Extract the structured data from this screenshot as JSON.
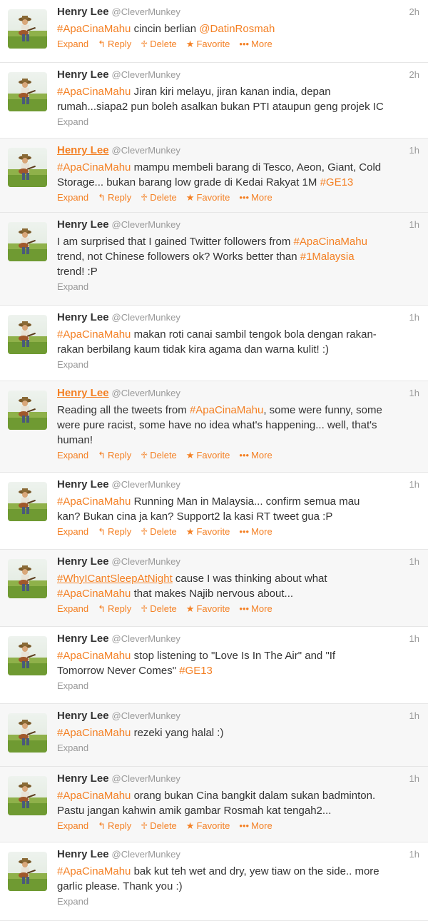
{
  "tweets": [
    {
      "name": "Henry Lee",
      "handle": "@CleverMunkey",
      "time": "2h",
      "lines": [
        [
          {
            "t": "#ApaCinaMahu",
            "h": true
          },
          {
            "t": " cincin berlian "
          },
          {
            "t": "@DatinRosmah",
            "h": true
          }
        ]
      ],
      "full_actions": true
    },
    {
      "name": "Henry Lee",
      "handle": "@CleverMunkey",
      "time": "2h",
      "lines": [
        [
          {
            "t": "#ApaCinaMahu",
            "h": true
          },
          {
            "t": " Jiran kiri melayu, jiran kanan india, depan"
          }
        ],
        [
          {
            "t": "rumah...siapa2 pun boleh asalkan bukan PTI ataupun geng projek IC"
          }
        ]
      ],
      "full_actions": false
    },
    {
      "name": "Henry Lee",
      "handle": "@CleverMunkey",
      "time": "1h",
      "name_hover": true,
      "lines": [
        [
          {
            "t": "#ApaCinaMahu",
            "h": true
          },
          {
            "t": " mampu membeli barang di Tesco, Aeon, Giant, Cold"
          }
        ],
        [
          {
            "t": "Storage... bukan barang low grade di Kedai Rakyat 1M "
          },
          {
            "t": "#GE13",
            "h": true
          }
        ]
      ],
      "full_actions": true
    },
    {
      "name": "Henry Lee",
      "handle": "@CleverMunkey",
      "time": "1h",
      "lines": [
        [
          {
            "t": "I am surprised that I gained Twitter followers from "
          },
          {
            "t": "#ApaCinaMahu",
            "h": true
          }
        ],
        [
          {
            "t": "trend, not Chinese followers ok? Works better than "
          },
          {
            "t": "#1Malaysia",
            "h": true
          }
        ],
        [
          {
            "t": "trend! :P"
          }
        ]
      ],
      "full_actions": false
    },
    {
      "name": "Henry Lee",
      "handle": "@CleverMunkey",
      "time": "1h",
      "lines": [
        [
          {
            "t": "#ApaCinaMahu",
            "h": true
          },
          {
            "t": " makan roti canai sambil tengok bola dengan rakan-"
          }
        ],
        [
          {
            "t": "rakan berbilang kaum tidak kira agama dan warna kulit! :)"
          }
        ]
      ],
      "full_actions": false
    },
    {
      "name": "Henry Lee",
      "handle": "@CleverMunkey",
      "time": "1h",
      "name_hover": true,
      "lines": [
        [
          {
            "t": "Reading all the tweets from "
          },
          {
            "t": "#ApaCinaMahu",
            "h": true
          },
          {
            "t": ", some were funny, some"
          }
        ],
        [
          {
            "t": "were pure racist, some have no idea what's happening... well, that's"
          }
        ],
        [
          {
            "t": "human!"
          }
        ]
      ],
      "full_actions": true
    },
    {
      "name": "Henry Lee",
      "handle": "@CleverMunkey",
      "time": "1h",
      "lines": [
        [
          {
            "t": "#ApaCinaMahu",
            "h": true
          },
          {
            "t": " Running Man in Malaysia... confirm semua mau"
          }
        ],
        [
          {
            "t": "kan? Bukan cina ja kan? Support2 la kasi RT tweet gua :P"
          }
        ]
      ],
      "full_actions": true
    },
    {
      "name": "Henry Lee",
      "handle": "@CleverMunkey",
      "time": "1h",
      "lines": [
        [
          {
            "t": "#WhyICantSleepAtNight",
            "h": true,
            "u": true
          },
          {
            "t": " cause I was thinking about what"
          }
        ],
        [
          {
            "t": "#ApaCinaMahu",
            "h": true
          },
          {
            "t": " that makes Najib nervous about..."
          }
        ]
      ],
      "full_actions": true
    },
    {
      "name": "Henry Lee",
      "handle": "@CleverMunkey",
      "time": "1h",
      "lines": [
        [
          {
            "t": "#ApaCinaMahu",
            "h": true
          },
          {
            "t": " stop listening to \"Love Is In The Air\" and \"If"
          }
        ],
        [
          {
            "t": "Tomorrow Never Comes\" "
          },
          {
            "t": "#GE13",
            "h": true
          }
        ]
      ],
      "full_actions": false
    },
    {
      "name": "Henry Lee",
      "handle": "@CleverMunkey",
      "time": "1h",
      "lines": [
        [
          {
            "t": "#ApaCinaMahu",
            "h": true
          },
          {
            "t": " rezeki yang halal :)"
          }
        ]
      ],
      "full_actions": false
    },
    {
      "name": "Henry Lee",
      "handle": "@CleverMunkey",
      "time": "1h",
      "lines": [
        [
          {
            "t": "#ApaCinaMahu",
            "h": true
          },
          {
            "t": " orang bukan Cina bangkit dalam sukan badminton."
          }
        ],
        [
          {
            "t": "Pastu jangan kahwin amik gambar Rosmah kat tengah2..."
          }
        ]
      ],
      "full_actions": true
    },
    {
      "name": "Henry Lee",
      "handle": "@CleverMunkey",
      "time": "1h",
      "lines": [
        [
          {
            "t": "#ApaCinaMahu",
            "h": true
          },
          {
            "t": " bak kut teh wet and dry, yew tiaw on the side.. more"
          }
        ],
        [
          {
            "t": "garlic please. Thank you :)"
          }
        ]
      ],
      "full_actions": false
    }
  ],
  "actions": {
    "expand": "Expand",
    "reply": "Reply",
    "delete": "Delete",
    "favorite": "Favorite",
    "more": "More"
  },
  "icons": {
    "reply": "reply-arrow-icon",
    "delete": "trash-icon",
    "favorite": "star-icon",
    "more": "ellipsis-icon"
  },
  "colors": {
    "accent": "#f48024",
    "muted": "#999999",
    "text": "#333333"
  }
}
